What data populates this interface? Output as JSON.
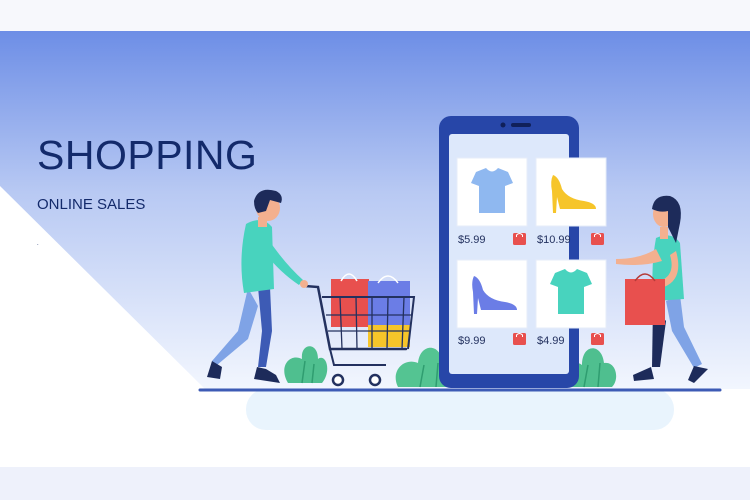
{
  "banner": {
    "headline": "SHOPPING",
    "subtitle": "ONLINE SALES",
    "dot": "."
  },
  "products": [
    {
      "item": "t-shirt",
      "price": "$5.99"
    },
    {
      "item": "high-heel",
      "price": "$10.99"
    },
    {
      "item": "heel-shoe",
      "price": "$9.99"
    },
    {
      "item": "t-shirt",
      "price": "$4.99"
    }
  ],
  "colors": {
    "gradient_top": "#6d8ee6",
    "gradient_bottom": "#eef3fd",
    "phone": "#2746a8",
    "title": "#132a6b",
    "cart_icon": "#e8504e",
    "plant": "#4fbf8f"
  }
}
